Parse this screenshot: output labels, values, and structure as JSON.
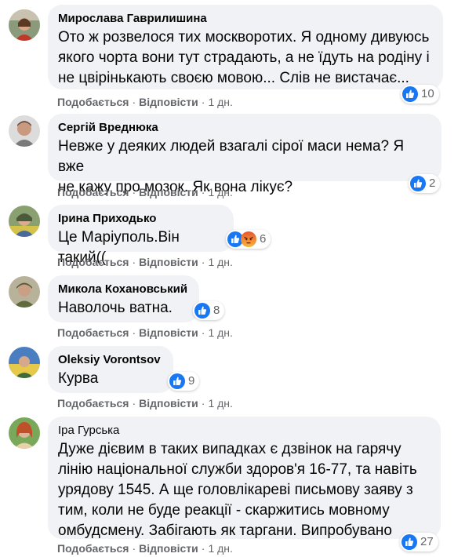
{
  "ui": {
    "like_label": "Подобається",
    "reply_label": "Відповісти",
    "separator": "·"
  },
  "colors": {
    "bubble": "#f0f2f5",
    "meta_text": "#65676b",
    "like_blue": "#1877f2"
  },
  "comments": [
    {
      "author": "Мирослава Гаврилишина",
      "lines": [
        "Ото ж розвелося тих москворотих. Я одному дивуюсь",
        "якого чорта вони тут страдають, а не їдуть на родіну і",
        "не цвірінькають своєю мовою... Слів не вистачає..."
      ],
      "time": "1 дн.",
      "reactions": [
        "like-icon"
      ],
      "reaction_count": "10"
    },
    {
      "author": "Сергій Вреднюка",
      "lines": [
        "Невже у деяких людей взагалі сірої маси нема? Я вже",
        "не кажу про мозок. Як вона лікує?"
      ],
      "time": "1 дн.",
      "reactions": [
        "like-icon"
      ],
      "reaction_count": "2"
    },
    {
      "author": "Ірина Приходько",
      "lines": [
        "Це Маріуполь.Він такий(("
      ],
      "time": "1 дн.",
      "reactions": [
        "like-icon",
        "angry-icon"
      ],
      "reaction_count": "6"
    },
    {
      "author": "Микола Кохановський",
      "lines": [
        "Наволочь ватна."
      ],
      "time": "1 дн.",
      "reactions": [
        "like-icon"
      ],
      "reaction_count": "8"
    },
    {
      "author": "Oleksiy Vorontsov",
      "lines": [
        "Курва"
      ],
      "time": "1 дн.",
      "reactions": [
        "like-icon"
      ],
      "reaction_count": "9"
    },
    {
      "author": "Іра Гурська",
      "lines": [
        "Дуже дієвим в таких випадках є дзвінок на гарячу",
        "лінію національної служби здоров'я 16-77, та навіть",
        "урядову 1545. А ще головлікареві письмову заяву з",
        "тим, коли не буде реакції - скаржитись мовному",
        "омбудсмену. Забігають як таргани. Випробувано"
      ],
      "time": "1 дн.",
      "reactions": [
        "like-icon"
      ],
      "reaction_count": "27"
    }
  ]
}
